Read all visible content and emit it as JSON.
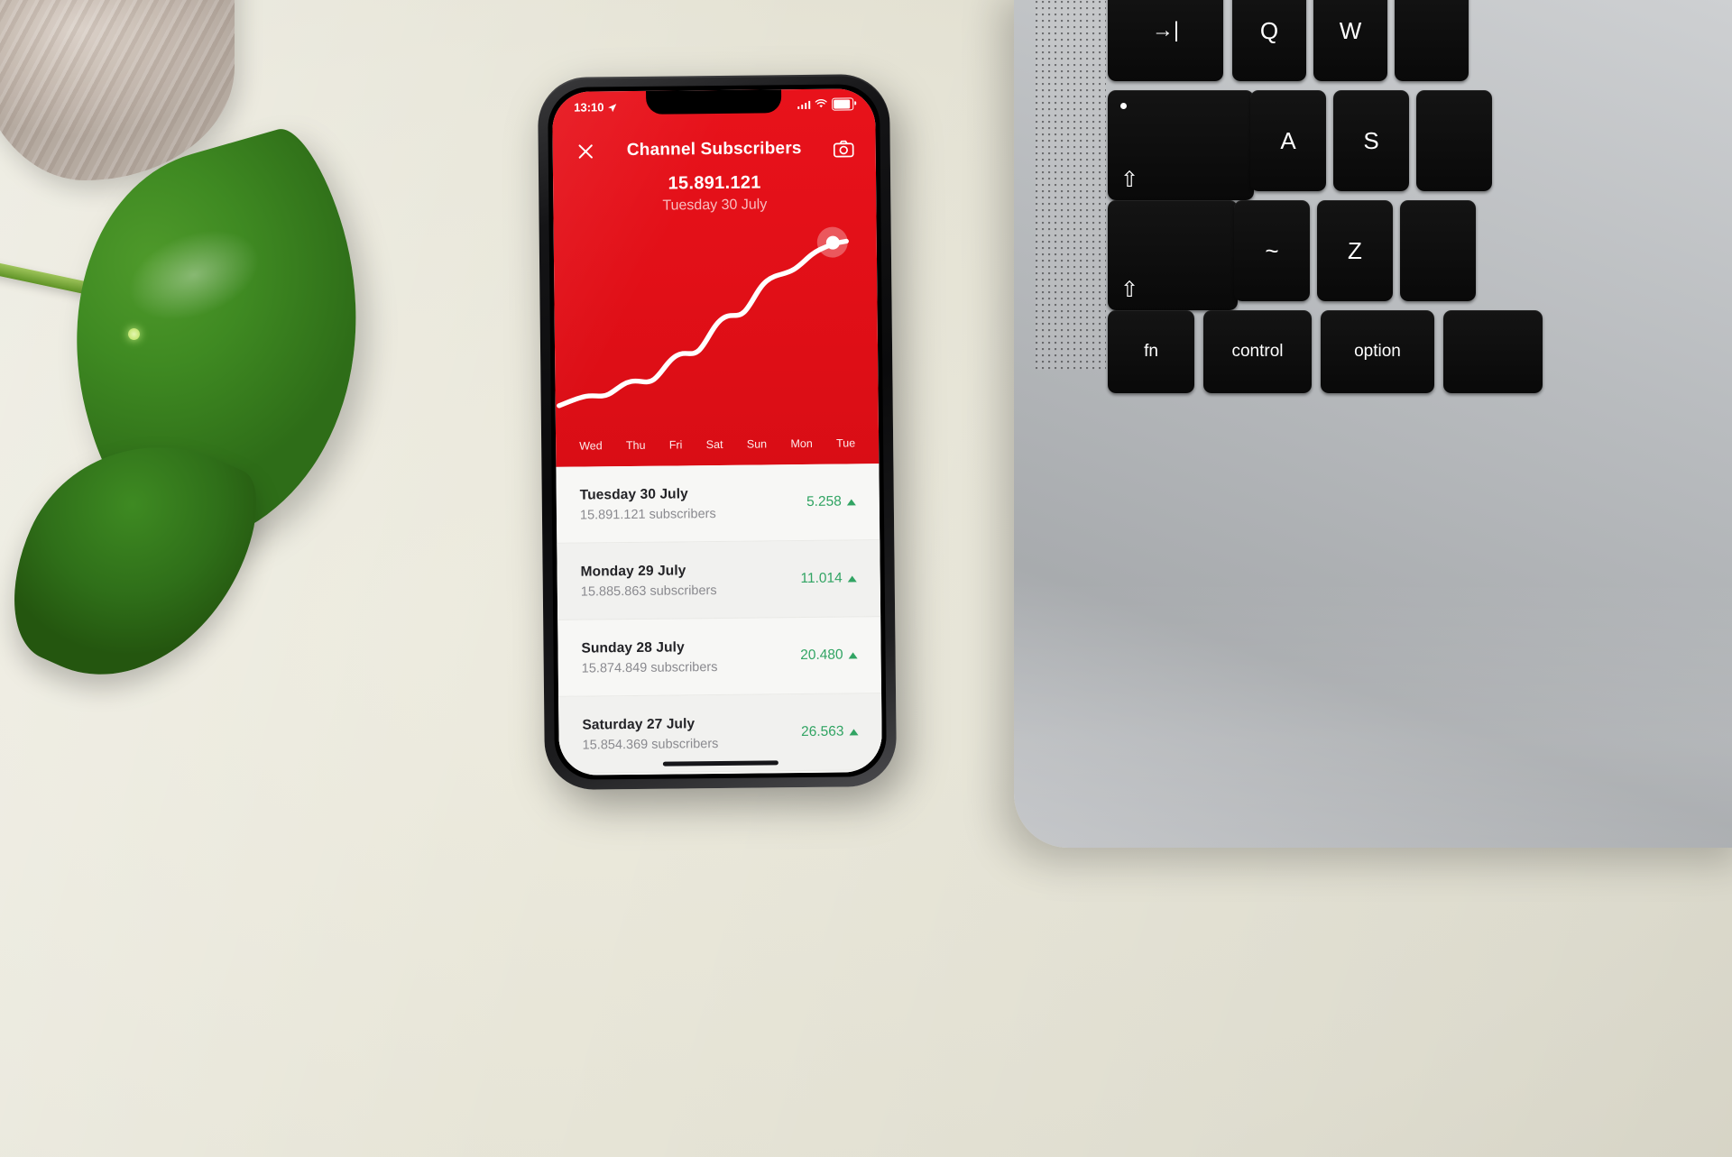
{
  "scene": {
    "description": "smartphone-on-desk-photo",
    "background_color": "#e9e7da"
  },
  "phone": {
    "status_bar": {
      "time": "13:10",
      "location_icon": "location-arrow-icon",
      "signal_icon": "cellular-signal-icon",
      "wifi_icon": "wifi-icon",
      "battery_icon": "battery-icon"
    },
    "navbar": {
      "close_icon": "close-icon",
      "title": "Channel Subscribers",
      "camera_icon": "camera-icon"
    },
    "readout": {
      "value": "15.891.121",
      "date": "Tuesday 30 July"
    },
    "accent_color": "#e2121b",
    "positive_color": "#31a463",
    "list_bg": "#f7f7f5"
  },
  "chart_data": {
    "type": "line",
    "title": "Channel Subscribers",
    "xlabel": "",
    "ylabel": "",
    "categories": [
      "Wed",
      "Thu",
      "Fri",
      "Sat",
      "Sun",
      "Mon",
      "Tue"
    ],
    "x": [
      0,
      1,
      2,
      3,
      4,
      5,
      6
    ],
    "series": [
      {
        "name": "Subscribers",
        "values": [
          15720000,
          15760000,
          15790000,
          15812000,
          15838000,
          15874849,
          15891121
        ]
      }
    ],
    "ylim": [
      15700000,
      15900000
    ],
    "grid": false,
    "legend": "none",
    "line_color": "#ffffff",
    "plot_bg": "#e2121b",
    "marker": {
      "label": "Tuesday 30 July",
      "value": "15.891.121",
      "at_category": "Tue"
    }
  },
  "list": {
    "rows": [
      {
        "date": "Tuesday 30 July",
        "subscribers": "15.891.121 subscribers",
        "delta": "5.258",
        "direction": "up"
      },
      {
        "date": "Monday 29 July",
        "subscribers": "15.885.863 subscribers",
        "delta": "11.014",
        "direction": "up"
      },
      {
        "date": "Sunday 28 July",
        "subscribers": "15.874.849 subscribers",
        "delta": "20.480",
        "direction": "up"
      },
      {
        "date": "Saturday 27 July",
        "subscribers": "15.854.369 subscribers",
        "delta": "26.563",
        "direction": "up"
      }
    ]
  },
  "laptop": {
    "keys": [
      {
        "label": "→|",
        "name": "tab-key"
      },
      {
        "label": "Q",
        "name": "q-key"
      },
      {
        "label": "W",
        "name": "w-key"
      },
      {
        "label": "⇧",
        "name": "caps-lock-key"
      },
      {
        "label": "A",
        "name": "a-key"
      },
      {
        "label": "S",
        "name": "s-key"
      },
      {
        "label": "⇧",
        "name": "shift-key"
      },
      {
        "label": "~",
        "name": "tilde-key"
      },
      {
        "label": "Z",
        "name": "z-key"
      },
      {
        "label": "fn",
        "name": "fn-key"
      },
      {
        "label": "control",
        "name": "control-key"
      },
      {
        "label": "option",
        "name": "option-key"
      },
      {
        "label": "^",
        "name": "caret-key"
      },
      {
        "label": "⌥",
        "name": "alt-key"
      }
    ]
  }
}
